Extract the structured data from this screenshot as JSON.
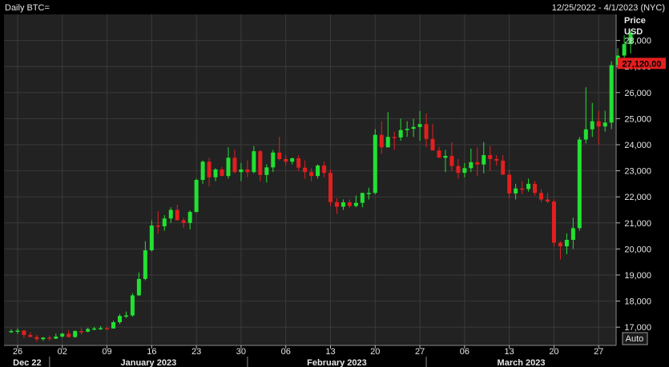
{
  "header": {
    "title": "Daily BTC=",
    "date_range": "12/25/2022 - 4/1/2023 (NYC)"
  },
  "axis_header": {
    "line1": "Price",
    "line2": "USD"
  },
  "auto_button": "Auto",
  "last_price_label": "27,120.00",
  "colors": {
    "up": "#22e032",
    "down": "#e21f1f",
    "grid": "#3a3a3a",
    "bg": "#000000",
    "plot_bg": "#222222"
  },
  "chart_data": {
    "type": "candlestick",
    "title": "Daily BTC=",
    "ylabel": "Price USD",
    "ylim": [
      16300,
      29000
    ],
    "grid": true,
    "yticks": [
      17000,
      18000,
      19000,
      20000,
      21000,
      22000,
      23000,
      24000,
      25000,
      26000,
      27000,
      28000
    ],
    "ytick_labels": [
      "17,000",
      "18,000",
      "19,000",
      "20,000",
      "21,000",
      "22,000",
      "23,000",
      "24,000",
      "25,000",
      "26,000",
      "27,000",
      "28,000"
    ],
    "xticks": [
      {
        "day": 1,
        "label": "26"
      },
      {
        "day": 8,
        "label": "02"
      },
      {
        "day": 15,
        "label": "09"
      },
      {
        "day": 22,
        "label": "16"
      },
      {
        "day": 29,
        "label": "23"
      },
      {
        "day": 36,
        "label": "30"
      },
      {
        "day": 43,
        "label": "06"
      },
      {
        "day": 50,
        "label": "13"
      },
      {
        "day": 57,
        "label": "20"
      },
      {
        "day": 64,
        "label": "27"
      },
      {
        "day": 71,
        "label": "06"
      },
      {
        "day": 78,
        "label": "13"
      },
      {
        "day": 85,
        "label": "20"
      },
      {
        "day": 92,
        "label": "27"
      }
    ],
    "months": [
      {
        "label": "Dec 22",
        "start": -1,
        "end": 6
      },
      {
        "label": "January 2023",
        "start": 6,
        "end": 37
      },
      {
        "label": "February 2023",
        "start": 37,
        "end": 65
      },
      {
        "label": "March 2023",
        "start": 65,
        "end": 96
      }
    ],
    "last_price": 27120,
    "dates_start": "2022-12-25",
    "ohlc": [
      [
        16840,
        16920,
        16780,
        16850
      ],
      [
        16850,
        16960,
        16740,
        16870
      ],
      [
        16870,
        16890,
        16580,
        16700
      ],
      [
        16700,
        16800,
        16640,
        16620
      ],
      [
        16620,
        16700,
        16440,
        16540
      ],
      [
        16540,
        16620,
        16470,
        16600
      ],
      [
        16600,
        16680,
        16480,
        16560
      ],
      [
        16560,
        16760,
        16540,
        16640
      ],
      [
        16640,
        16780,
        16600,
        16750
      ],
      [
        16750,
        16880,
        16600,
        16620
      ],
      [
        16620,
        16880,
        16600,
        16850
      ],
      [
        16850,
        16970,
        16720,
        16830
      ],
      [
        16830,
        16980,
        16800,
        16930
      ],
      [
        16930,
        17010,
        16880,
        16950
      ],
      [
        16950,
        17040,
        16900,
        16960
      ],
      [
        16960,
        17020,
        16900,
        16950
      ],
      [
        16950,
        17250,
        16950,
        17190
      ],
      [
        17190,
        17500,
        17120,
        17430
      ],
      [
        17430,
        17600,
        17350,
        17450
      ],
      [
        17450,
        18300,
        17400,
        18220
      ],
      [
        18220,
        19100,
        18200,
        18850
      ],
      [
        18850,
        20300,
        18800,
        19950
      ],
      [
        19950,
        21100,
        19900,
        20900
      ],
      [
        20900,
        21450,
        20600,
        20870
      ],
      [
        20870,
        21300,
        20700,
        21170
      ],
      [
        21170,
        21600,
        21000,
        21500
      ],
      [
        21500,
        21700,
        21100,
        21100
      ],
      [
        21100,
        21200,
        20800,
        21000
      ],
      [
        21000,
        21480,
        20750,
        21420
      ],
      [
        21420,
        22700,
        21400,
        22650
      ],
      [
        22650,
        23400,
        22500,
        23350
      ],
      [
        23350,
        23500,
        22400,
        22750
      ],
      [
        22750,
        23100,
        22600,
        23050
      ],
      [
        23050,
        23150,
        22800,
        22800
      ],
      [
        22800,
        23900,
        22700,
        23500
      ],
      [
        23500,
        23800,
        22900,
        22950
      ],
      [
        22950,
        23300,
        22600,
        23050
      ],
      [
        23050,
        23400,
        22750,
        22950
      ],
      [
        22950,
        23950,
        22900,
        23750
      ],
      [
        23750,
        23800,
        22600,
        22840
      ],
      [
        22840,
        23250,
        22550,
        23130
      ],
      [
        23130,
        23800,
        22950,
        23700
      ],
      [
        23700,
        24300,
        23400,
        23450
      ],
      [
        23450,
        23600,
        23200,
        23350
      ],
      [
        23350,
        23500,
        23250,
        23480
      ],
      [
        23480,
        23600,
        23000,
        23120
      ],
      [
        23120,
        23400,
        22700,
        22950
      ],
      [
        22950,
        23100,
        22600,
        22800
      ],
      [
        22800,
        23250,
        22700,
        23200
      ],
      [
        23200,
        23350,
        22750,
        22920
      ],
      [
        22920,
        23050,
        21650,
        21800
      ],
      [
        21800,
        21950,
        21350,
        21620
      ],
      [
        21620,
        21900,
        21500,
        21790
      ],
      [
        21790,
        21900,
        21580,
        21650
      ],
      [
        21650,
        22050,
        21600,
        21770
      ],
      [
        21770,
        22150,
        21600,
        22150
      ],
      [
        22150,
        22350,
        21900,
        22150
      ],
      [
        22150,
        24600,
        22100,
        24380
      ],
      [
        24380,
        24900,
        23650,
        23900
      ],
      [
        23900,
        25250,
        23900,
        24300
      ],
      [
        24300,
        24500,
        23800,
        24280
      ],
      [
        24280,
        25000,
        24150,
        24560
      ],
      [
        24560,
        24900,
        24300,
        24610
      ],
      [
        24610,
        25000,
        24300,
        24680
      ],
      [
        24680,
        25300,
        24150,
        24790
      ],
      [
        24790,
        25200,
        23900,
        24220
      ],
      [
        24220,
        24800,
        24000,
        23780
      ],
      [
        23780,
        23920,
        23550,
        23500
      ],
      [
        23500,
        23800,
        22950,
        23570
      ],
      [
        23570,
        24100,
        23000,
        23180
      ],
      [
        23180,
        23450,
        22700,
        22920
      ],
      [
        22920,
        23300,
        22750,
        23100
      ],
      [
        23100,
        23850,
        22950,
        23330
      ],
      [
        23330,
        23900,
        22800,
        23240
      ],
      [
        23240,
        24100,
        22900,
        23600
      ],
      [
        23600,
        23950,
        23000,
        23450
      ],
      [
        23450,
        23600,
        23200,
        23390
      ],
      [
        23390,
        23600,
        23200,
        22850
      ],
      [
        22850,
        23050,
        21950,
        22130
      ],
      [
        22130,
        22500,
        21900,
        22320
      ],
      [
        22320,
        22600,
        22100,
        22300
      ],
      [
        22300,
        22700,
        22200,
        22500
      ],
      [
        22500,
        22600,
        22050,
        22150
      ],
      [
        22150,
        22300,
        21800,
        21900
      ],
      [
        21900,
        22150,
        21750,
        21820
      ],
      [
        21820,
        21900,
        20100,
        20240
      ],
      [
        20240,
        20300,
        19600,
        20100
      ],
      [
        20100,
        20600,
        19800,
        20350
      ],
      [
        20350,
        21200,
        20000,
        20800
      ],
      [
        20800,
        24300,
        20700,
        24200
      ],
      [
        24200,
        26200,
        24050,
        24590
      ],
      [
        24590,
        25600,
        24300,
        24900
      ],
      [
        24900,
        25300,
        24000,
        24700
      ],
      [
        24700,
        25300,
        24500,
        24850
      ],
      [
        24850,
        27200,
        24600,
        27050
      ],
      [
        27050,
        27700,
        26900,
        27420
      ],
      [
        27420,
        28200,
        27100,
        27860
      ],
      [
        27860,
        28400,
        27500,
        28300
      ]
    ]
  }
}
